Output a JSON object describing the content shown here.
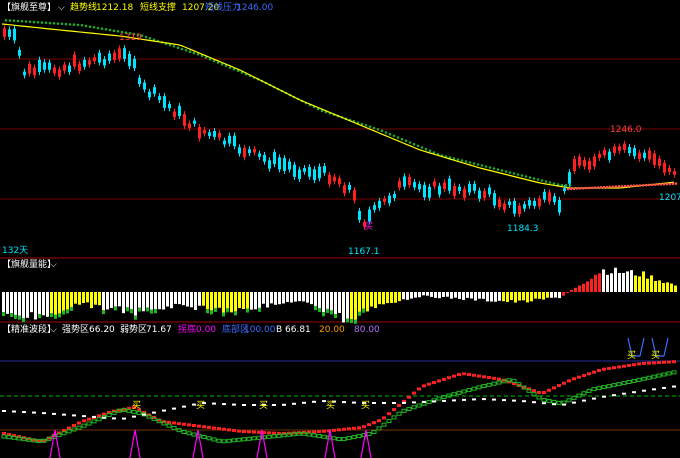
{
  "panels": {
    "main": {
      "name": "【旗舰至尊】",
      "items": [
        {
          "label": "趋势线",
          "value": "1212.18",
          "color": "#ffff00"
        },
        {
          "label": "短线支撑",
          "value": "1207.20",
          "color": "#ffff00"
        },
        {
          "label": "短线压力",
          "value": "1246.00",
          "color": "#3a6bff"
        }
      ],
      "annotations": {
        "peak_left": "1319",
        "high_right": "1246.0",
        "low_main": "1167.1",
        "low_mid": "1184.3",
        "right_edge": "1207",
        "days": "132天",
        "mark_mid": "买"
      }
    },
    "volume": {
      "name": "【旗舰量能】"
    },
    "band": {
      "name": "【精准波段】",
      "items": [
        {
          "label": "强势区",
          "value": "66.20",
          "color": "#ffffff"
        },
        {
          "label": "弱势区",
          "value": "71.67",
          "color": "#ffffff"
        },
        {
          "label": "拐底",
          "value": "0.00",
          "color": "#ff00ff"
        },
        {
          "label": "底部区",
          "value": "100.00",
          "color": "#3a6bff"
        },
        {
          "label": "B",
          "value": "66.81",
          "color": "#ffffff"
        },
        {
          "label": "",
          "value": "20.00",
          "color": "#ff9900"
        },
        {
          "label": "",
          "value": "80.00",
          "color": "#b070ff"
        }
      ],
      "signals": [
        "买",
        "买",
        "买",
        "买",
        "买",
        "买",
        "买"
      ]
    }
  },
  "colors": {
    "up": "#ff2020",
    "down": "#00e5ff",
    "ma_yellow": "#ffff00",
    "ma_green": "#1fa82a",
    "grid": "#7a0000",
    "panel_sep": "#a00000"
  }
}
